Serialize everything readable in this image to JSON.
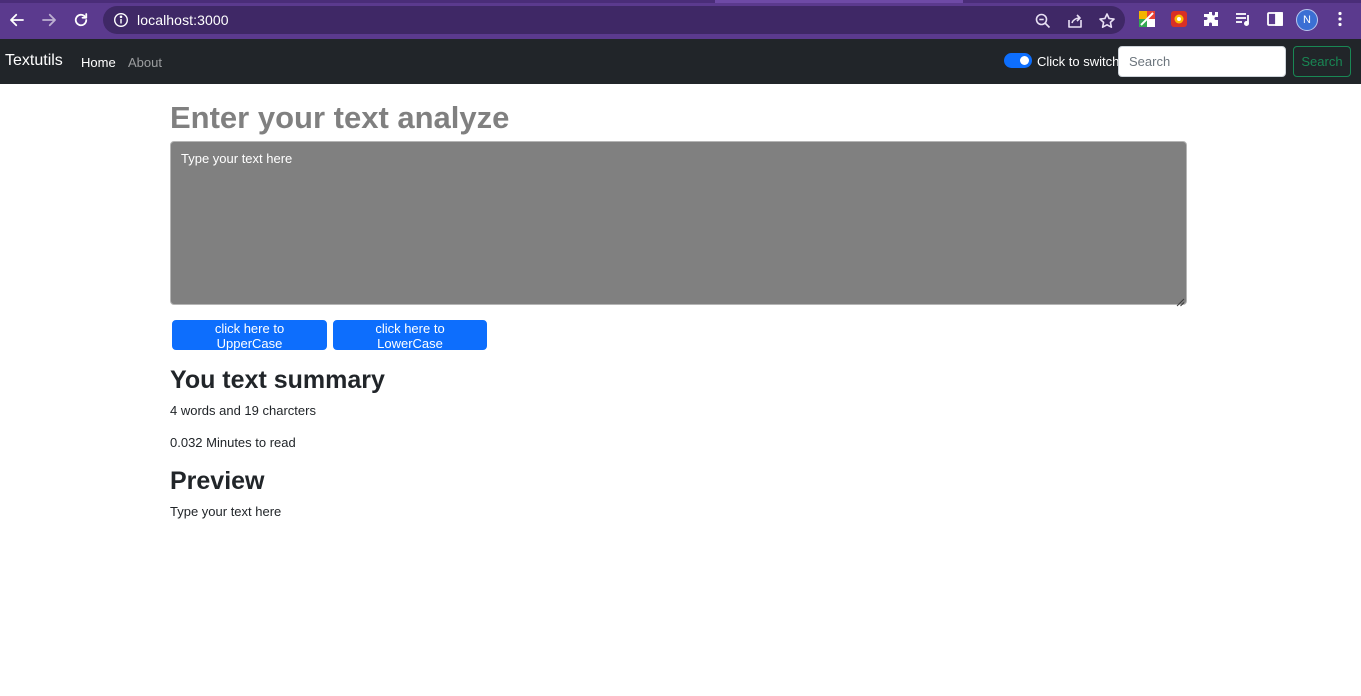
{
  "browser": {
    "url": "localhost:3000",
    "avatar_initial": "N",
    "icons": [
      "back-arrow-icon",
      "forward-arrow-icon",
      "reload-icon",
      "info-icon",
      "zoom-icon",
      "share-icon",
      "star-icon",
      "extension-icon",
      "puzzle-icon",
      "media-icon",
      "sidepanel-icon",
      "kebab-menu-icon"
    ],
    "colors": {
      "frame": "#5b3a8e",
      "omnibox": "#3f2866"
    }
  },
  "navbar": {
    "brand": "Textutils",
    "links": [
      {
        "label": "Home",
        "active": true
      },
      {
        "label": "About",
        "active": false
      }
    ],
    "switch_label": "Click to switch",
    "switch_on": true,
    "search_placeholder": "Search",
    "search_button": "Search",
    "colors": {
      "background": "#212529",
      "switch": "#0d6efd",
      "search_button": "#198754"
    }
  },
  "main": {
    "heading": "Enter your text analyze",
    "textarea_placeholder": "Type your text here",
    "buttons": {
      "upper": "click here to UpperCase",
      "lower": "click here to LowerCase"
    },
    "summary_title": "You text summary",
    "counts_text": "4 words and 19 charcters",
    "read_time_text": "0.032 Minutes to read",
    "preview_title": "Preview",
    "preview_text": "Type your text here",
    "colors": {
      "textarea_bg": "#808080",
      "primary": "#0d6efd",
      "heading": "#808080"
    }
  }
}
